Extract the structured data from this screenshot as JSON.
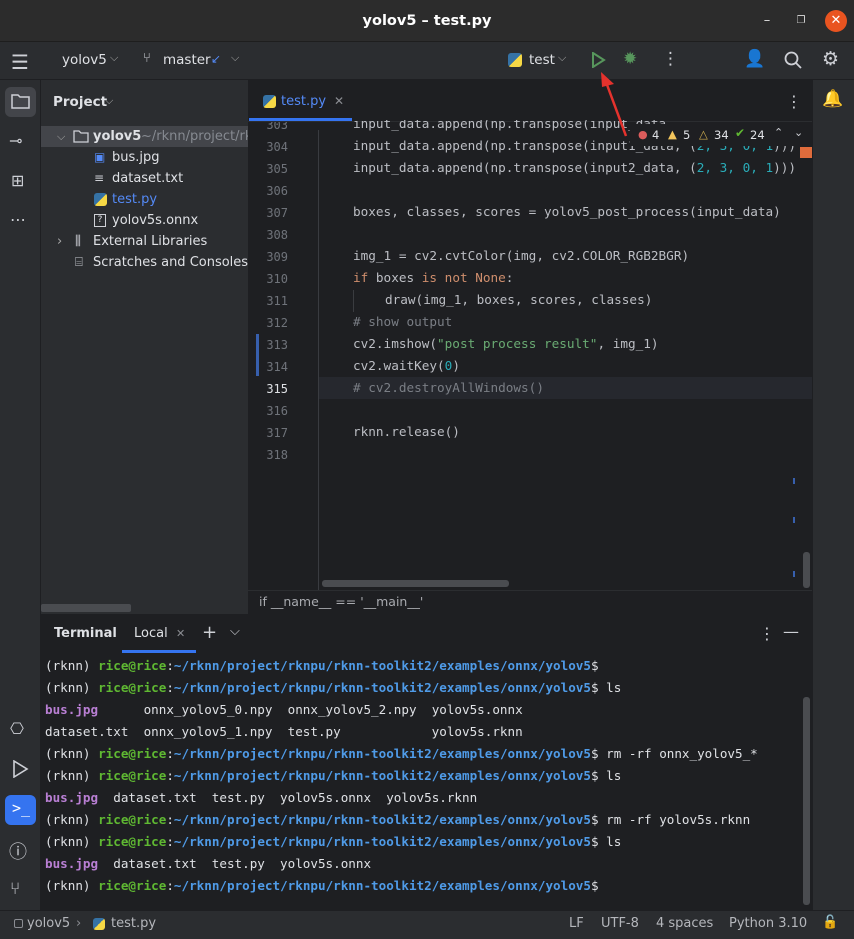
{
  "window": {
    "title": "yolov5 – test.py"
  },
  "toolbar": {
    "project": "yolov5",
    "branch": "master",
    "run_config": "test"
  },
  "project_panel": {
    "title": "Project",
    "root": {
      "name": "yolov5",
      "path": "~/rknn/project/rk"
    },
    "files": [
      "bus.jpg",
      "dataset.txt",
      "test.py",
      "yolov5s.onnx"
    ],
    "external": "External Libraries",
    "scratches": "Scratches and Consoles"
  },
  "editor": {
    "tab": "test.py",
    "inspections": {
      "errors": "4",
      "warnings": "5",
      "weak": "34",
      "ok": "24"
    },
    "breadcrumb": "if __name__ == '__main__'",
    "lines": [
      "303",
      "304",
      "305",
      "306",
      "307",
      "308",
      "309",
      "310",
      "311",
      "312",
      "313",
      "314",
      "315",
      "316",
      "317",
      "318"
    ],
    "code": {
      "l303": "input_data.append(np.transpose(input_data",
      "l304a": "input_data.append(np.transpose(input1_data, (",
      "l304n": "2, 3, 0, 1",
      "l304b": ")))",
      "l305a": "input_data.append(np.transpose(input2_data, (",
      "l305n": "2, 3, 0, 1",
      "l305b": ")))",
      "l307": "boxes, classes, scores = yolov5_post_process(input_data)",
      "l309": "img_1 = cv2.cvtColor(img, cv2.COLOR_RGB2BGR)",
      "l310k1": "if",
      "l310a": " boxes ",
      "l310k2": "is not None",
      "l310b": ":",
      "l311": "draw(img_1, boxes, scores, classes)",
      "l312": "# show output",
      "l313a": "cv2.imshow(",
      "l313s": "\"post process result\"",
      "l313b": ", img_1)",
      "l314a": "cv2.waitKey(",
      "l314n": "0",
      "l314b": ")",
      "l315": "# cv2.destroyAllWindows()",
      "l317": "rknn.release()"
    }
  },
  "terminal": {
    "tab_terminal": "Terminal",
    "tab_local": "Local",
    "prompt_env": "(rknn) ",
    "user": "rice@rice",
    "path": "~/rknn/project/rknpu/rknn-toolkit2/examples/onnx/yolov5",
    "dollar": "$",
    "cmd_ls": " ls",
    "cmd_rm1": " rm -rf onnx_yolov5_*",
    "cmd_rm2": " rm -rf yolov5s.rknn",
    "out1_bus": "bus.jpg",
    "out1_rest": "      onnx_yolov5_0.npy  onnx_yolov5_2.npy  yolov5s.onnx",
    "out2": "dataset.txt  onnx_yolov5_1.npy  test.py            yolov5s.rknn",
    "out3_bus": "bus.jpg",
    "out3_rest": "  dataset.txt  test.py  yolov5s.onnx  yolov5s.rknn",
    "out4_bus": "bus.jpg",
    "out4_rest": "  dataset.txt  test.py  yolov5s.onnx"
  },
  "statusbar": {
    "project": "yolov5",
    "file": "test.py",
    "line_sep": "LF",
    "encoding": "UTF-8",
    "indent": "4 spaces",
    "interpreter": "Python 3.10"
  },
  "colors": {
    "run": "#57965c",
    "debug": "#57965c",
    "annotation_arrow": "#e5322d",
    "active_file": "#548af7"
  }
}
